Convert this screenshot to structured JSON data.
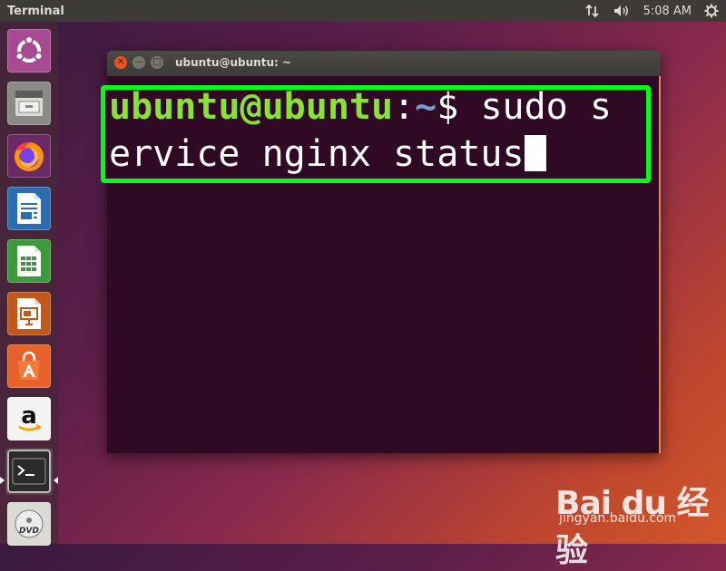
{
  "panel": {
    "app_title": "Terminal",
    "time": "5:08 AM"
  },
  "launcher": {
    "items": [
      {
        "name": "Ubuntu Dash",
        "icon": "ubuntu-dash-icon"
      },
      {
        "name": "Files",
        "icon": "files-icon"
      },
      {
        "name": "Firefox",
        "icon": "firefox-icon"
      },
      {
        "name": "LibreOffice Writer",
        "icon": "writer-icon"
      },
      {
        "name": "LibreOffice Calc",
        "icon": "calc-icon"
      },
      {
        "name": "LibreOffice Impress",
        "icon": "impress-icon"
      },
      {
        "name": "Ubuntu Software",
        "icon": "software-center-icon"
      },
      {
        "name": "Amazon",
        "icon": "amazon-icon",
        "letter": "a"
      },
      {
        "name": "Terminal",
        "icon": "terminal-icon",
        "glyph": ">_"
      },
      {
        "name": "DVD",
        "icon": "dvd-icon",
        "letter": "DVD"
      }
    ]
  },
  "terminal": {
    "window_title": "ubuntu@ubuntu: ~",
    "prompt_user": "ubuntu@ubuntu",
    "prompt_sep": ":",
    "prompt_path": "~",
    "prompt_symbol": "$ ",
    "command_line1": "sudo s",
    "command_line2": "ervice nginx status"
  },
  "watermark": {
    "logo": "Bai du 经验",
    "url": "jingyan.baidu.com"
  },
  "colors": {
    "ubuntu_orange": "#e95420",
    "terminal_bg": "#300a24",
    "prompt_user": "#8ae234",
    "prompt_path": "#729fcf",
    "highlight": "#00ff14"
  }
}
